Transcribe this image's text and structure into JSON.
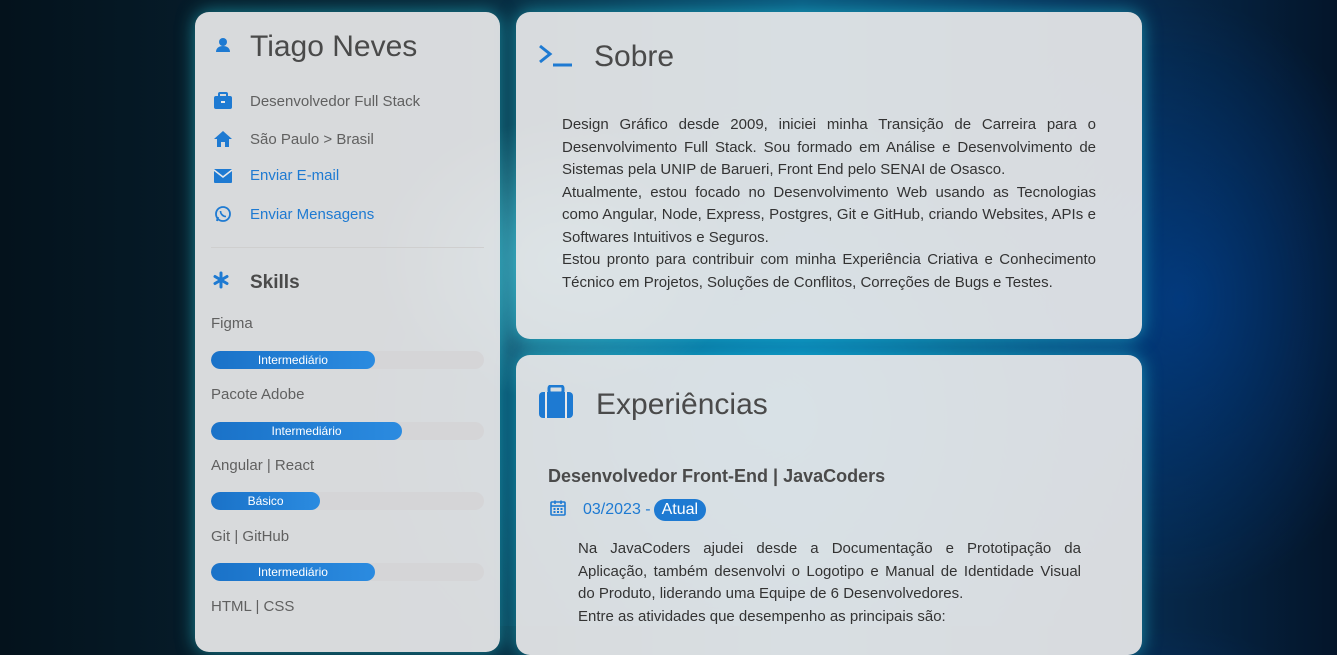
{
  "profile": {
    "name": "Tiago Neves",
    "role": "Desenvolvedor Full Stack",
    "location": "São Paulo > Brasil",
    "email_link": "Enviar E-mail",
    "message_link": "Enviar Mensagens"
  },
  "skills": {
    "title": "Skills",
    "items": [
      {
        "name": "Figma",
        "level": "Intermediário",
        "percent": 60
      },
      {
        "name": "Pacote Adobe",
        "level": "Intermediário",
        "percent": 70
      },
      {
        "name": "Angular | React",
        "level": "Básico",
        "percent": 40
      },
      {
        "name": "Git | GitHub",
        "level": "Intermediário",
        "percent": 60
      },
      {
        "name": "HTML | CSS",
        "level": "",
        "percent": 0
      }
    ]
  },
  "about": {
    "title": "Sobre",
    "paragraphs": [
      "Design Gráfico desde 2009, iniciei minha Transição de Carreira para o Desenvolvimento Full Stack. Sou formado em Análise e Desenvolvimento de Sistemas pela UNIP de Barueri, Front End pelo SENAI de Osasco.",
      "Atualmente, estou focado no Desenvolvimento Web usando as Tecnologias como Angular, Node, Express, Postgres, Git e GitHub, criando Websites, APIs e Softwares Intuitivos e Seguros.",
      "Estou pronto para contribuir com minha Experiência Criativa e Conhecimento Técnico em Projetos, Soluções de Conflitos, Correções de Bugs e Testes."
    ]
  },
  "experience": {
    "title": "Experiências",
    "job_title": "Desenvolvedor Front-End | JavaCoders",
    "date": "03/2023 -",
    "status": "Atual",
    "paragraphs": [
      "Na JavaCoders ajudei desde a Documentação e Prototipação da Aplicação, também desenvolvi o Logotipo e Manual de Identidade Visual do Produto, liderando uma Equipe de 6 Desenvolvedores.",
      "Entre as atividades que desempenho as principais são:"
    ]
  },
  "colors": {
    "accent": "#1e7ad2",
    "card": "#e8e8ea",
    "glow": "#28dcf0"
  }
}
